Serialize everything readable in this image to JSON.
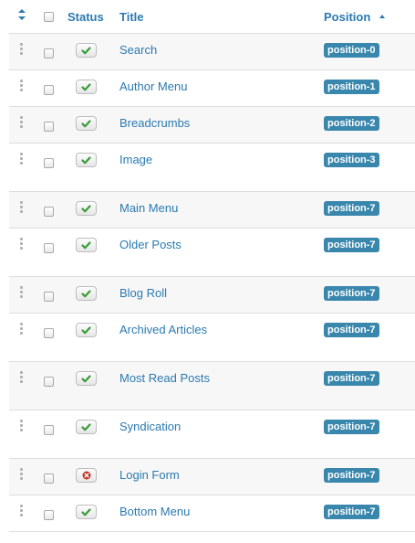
{
  "header": {
    "status_label": "Status",
    "title_label": "Title",
    "position_label": "Position"
  },
  "colors": {
    "link": "#2a7ab0",
    "badge": "#3a87ad",
    "published": "#3a9b3a",
    "unpublished": "#c0392b"
  },
  "rows": [
    {
      "title": "Search",
      "position": "position-0",
      "status": "published",
      "icon": "check-icon"
    },
    {
      "title": "Author Menu",
      "position": "position-1",
      "status": "published",
      "icon": "check-icon"
    },
    {
      "title": "Breadcrumbs",
      "position": "position-2",
      "status": "published",
      "icon": "check-icon"
    },
    {
      "title": "Image",
      "position": "position-3",
      "status": "published",
      "icon": "check-icon"
    },
    {
      "title": "Main Menu",
      "position": "position-7",
      "status": "published",
      "icon": "check-icon"
    },
    {
      "title": "Older Posts",
      "position": "position-7",
      "status": "published",
      "icon": "check-icon"
    },
    {
      "title": "Blog Roll",
      "position": "position-7",
      "status": "published",
      "icon": "check-icon"
    },
    {
      "title": "Archived Articles",
      "position": "position-7",
      "status": "published",
      "icon": "check-icon"
    },
    {
      "title": "Most Read Posts",
      "position": "position-7",
      "status": "published",
      "icon": "check-icon"
    },
    {
      "title": "Syndication",
      "position": "position-7",
      "status": "published",
      "icon": "check-icon"
    },
    {
      "title": "Login Form",
      "position": "position-7",
      "status": "unpublished",
      "icon": "x-circle-icon"
    },
    {
      "title": "Bottom Menu",
      "position": "position-7",
      "status": "published",
      "icon": "check-icon"
    }
  ]
}
